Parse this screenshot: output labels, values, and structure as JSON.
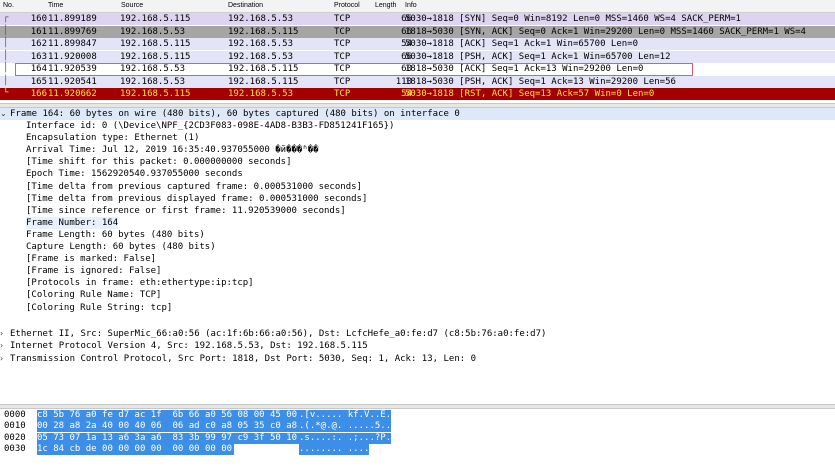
{
  "columns": {
    "no": "No.",
    "time": "Time",
    "source": "Source",
    "destination": "Destination",
    "protocol": "Protocol",
    "length": "Length",
    "info": "Info"
  },
  "packets": [
    {
      "no": "160",
      "time": "11.899189",
      "src": "192.168.5.115",
      "dst": "192.168.5.53",
      "proto": "TCP",
      "len": "66",
      "info": "5030→1818 [SYN] Seq=0 Win=8192 Len=0 MSS=1460 WS=4 SACK_PERM=1",
      "bg": "#ded3f0",
      "fg": "#000000"
    },
    {
      "no": "161",
      "time": "11.899769",
      "src": "192.168.5.53",
      "dst": "192.168.5.115",
      "proto": "TCP",
      "len": "66",
      "info": "1818→5030 [SYN, ACK] Seq=0 Ack=1 Win=29200 Len=0 MSS=1460 SACK_PERM=1 WS=4",
      "bg": "#a5a5a5",
      "fg": "#000000"
    },
    {
      "no": "162",
      "time": "11.899847",
      "src": "192.168.5.115",
      "dst": "192.168.5.53",
      "proto": "TCP",
      "len": "54",
      "info": "5030→1818 [ACK] Seq=1 Ack=1 Win=65700 Len=0",
      "bg": "#e4e4f8",
      "fg": "#000000"
    },
    {
      "no": "163",
      "time": "11.920008",
      "src": "192.168.5.115",
      "dst": "192.168.5.53",
      "proto": "TCP",
      "len": "66",
      "info": "5030→1818 [PSH, ACK] Seq=1 Ack=1 Win=65700 Len=12",
      "bg": "#e4e4f8",
      "fg": "#000000"
    },
    {
      "no": "164",
      "time": "11.920539",
      "src": "192.168.5.53",
      "dst": "192.168.5.115",
      "proto": "TCP",
      "len": "60",
      "info": "1818→5030 [ACK] Seq=1 Ack=13 Win=29200 Len=0",
      "bg": "#ffffff",
      "fg": "#000000"
    },
    {
      "no": "165",
      "time": "11.920541",
      "src": "192.168.5.53",
      "dst": "192.168.5.115",
      "proto": "TCP",
      "len": "110",
      "info": "1818→5030 [PSH, ACK] Seq=1 Ack=13 Win=29200 Len=56",
      "bg": "#e4e4f8",
      "fg": "#000000"
    },
    {
      "no": "166",
      "time": "11.920662",
      "src": "192.168.5.115",
      "dst": "192.168.5.53",
      "proto": "TCP",
      "len": "54",
      "info": "5030→1818 [RST, ACK] Seq=13 Ack=57 Win=0 Len=0",
      "bg": "#a40000",
      "fg": "#ffe24a"
    }
  ],
  "details": {
    "frame": "Frame 164: 60 bytes on wire (480 bits), 60 bytes captured (480 bits) on interface 0",
    "fields": [
      "Interface id: 0 (\\Device\\NPF_{2CD3F083-098E-4AD8-B3B3-FD851241F165})",
      "Encapsulation type: Ethernet (1)",
      "Arrival Time: Jul 12, 2019 16:35:40.937055000 �й���ʱ��",
      "[Time shift for this packet: 0.000000000 seconds]",
      "Epoch Time: 1562920540.937055000 seconds",
      "[Time delta from previous captured frame: 0.000531000 seconds]",
      "[Time delta from previous displayed frame: 0.000531000 seconds]",
      "[Time since reference or first frame: 11.920539000 seconds]",
      "Frame Number: 164",
      "Frame Length: 60 bytes (480 bits)",
      "Capture Length: 60 bytes (480 bits)",
      "[Frame is marked: False]",
      "[Frame is ignored: False]",
      "[Protocols in frame: eth:ethertype:ip:tcp]",
      "[Coloring Rule Name: TCP]",
      "[Coloring Rule String: tcp]"
    ],
    "layers": [
      "Ethernet II, Src: SuperMic_66:a0:56 (ac:1f:6b:66:a0:56), Dst: LcfcHefe_a0:fe:d7 (c8:5b:76:a0:fe:d7)",
      "Internet Protocol Version 4, Src: 192.168.5.53, Dst: 192.168.5.115",
      "Transmission Control Protocol, Src Port: 1818, Dst Port: 5030, Seq: 1, Ack: 13, Len: 0"
    ]
  },
  "hex": [
    {
      "offset": "0000",
      "bytes": "c8 5b 76 a0 fe d7 ac 1f  6b 66 a0 56 08 00 45 00",
      "ascii": ".[v..... kf.V..E."
    },
    {
      "offset": "0010",
      "bytes": "00 28 a8 2a 40 00 40 06  06 ad c0 a8 05 35 c0 a8",
      "ascii": ".(.*@.@. .....5.."
    },
    {
      "offset": "0020",
      "bytes": "05 73 07 1a 13 a6 3a a6  83 3b 99 97 c9 3f 50 10",
      "ascii": ".s....:. .;...?P."
    },
    {
      "offset": "0030",
      "bytes": "1c 84 cb de 00 00 00 00  00 00 00 00",
      "ascii": "........ ...."
    }
  ],
  "colors": {
    "selected_outline": "#e06060",
    "hex_highlight": "#3d8ee6",
    "frame_row": "#dde9f8"
  }
}
